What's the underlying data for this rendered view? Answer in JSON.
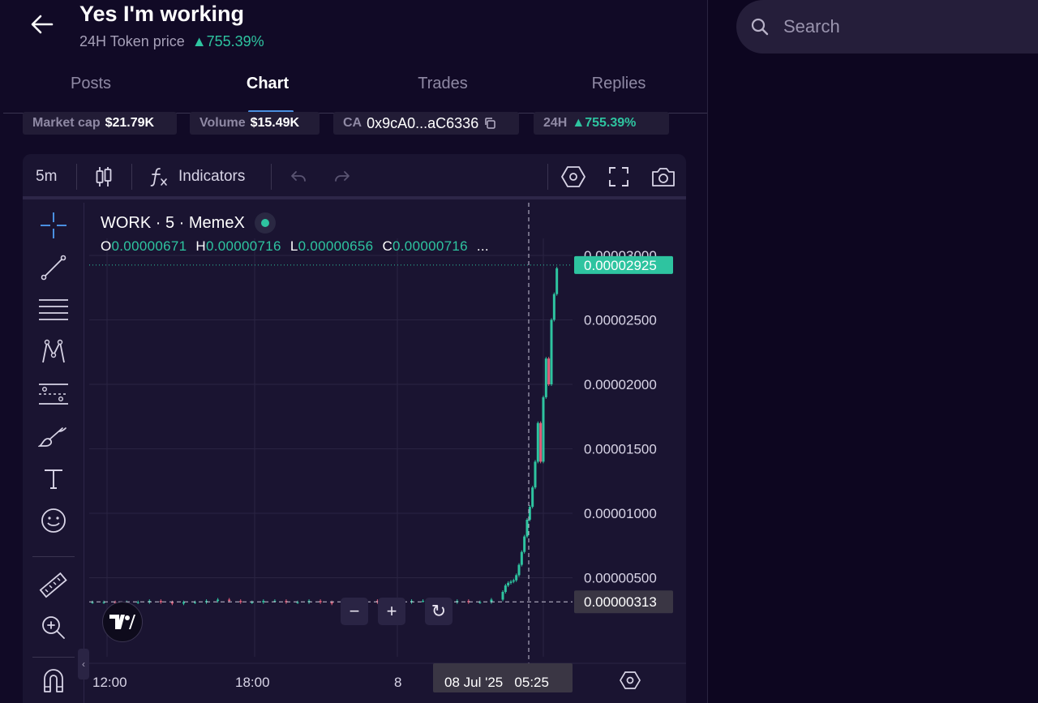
{
  "header": {
    "title": "Yes I'm working",
    "subtitle_label": "24H Token price",
    "subtitle_change": "▲755.39%"
  },
  "tabs": [
    {
      "label": "Posts"
    },
    {
      "label": "Chart"
    },
    {
      "label": "Trades"
    },
    {
      "label": "Replies"
    }
  ],
  "active_tab": "Chart",
  "stats": {
    "market_cap_label": "Market cap",
    "market_cap_value": "$21.79K",
    "volume_label": "Volume",
    "volume_value": "$15.49K",
    "ca_label": "CA",
    "ca_value": "0x9cA0...aC6336",
    "h24_label": "24H",
    "h24_value": "▲755.39%"
  },
  "toolbar": {
    "interval": "5m",
    "indicators_label": "Indicators"
  },
  "legend": {
    "symbol": "WORK · 5 · MemeX",
    "o_label": "O",
    "o_value": "0.00000671",
    "h_label": "H",
    "h_value": "0.00000716",
    "l_label": "L",
    "l_value": "0.00000656",
    "c_label": "C",
    "c_value": "0.00000716",
    "more": "..."
  },
  "price_scale": {
    "ticks": [
      "0.00003000",
      "0.00002500",
      "0.00002000",
      "0.00001500",
      "0.00001000",
      "0.00000500"
    ],
    "last_price_label": "0.00002925",
    "crosshair_price_label": "0.00000313"
  },
  "time_scale": {
    "ticks": [
      "12:00",
      "18:00",
      "8"
    ],
    "crosshair_time_label": "08 Jul '25   05:25"
  },
  "zoom_controls": {
    "minus": "−",
    "plus": "+",
    "reset": "↻"
  },
  "search": {
    "placeholder": "Search"
  },
  "colors": {
    "up": "#2ec4a0",
    "down": "#e0607a",
    "background": "#0d0620",
    "panel": "#110a26",
    "chart_bg": "#1a1431",
    "accent": "#4a8fe0"
  },
  "chart_data": {
    "type": "candlestick",
    "symbol": "WORK",
    "interval": "5",
    "ylim": [
      0,
      3e-05
    ],
    "price_ticks": [
      5e-06,
      1e-05,
      1.5e-05,
      2e-05,
      2.5e-05,
      3e-05
    ],
    "time_ticks": [
      "12:00",
      "18:00",
      "8"
    ],
    "last_price": 2.925e-05,
    "crosshair": {
      "price": 3.13e-06,
      "time": "08 Jul '25 05:25"
    },
    "closes": [
      3.1e-06,
      3.1e-06,
      3e-06,
      3.1e-06,
      3.1e-06,
      3.2e-06,
      3.1e-06,
      3e-06,
      3.1e-06,
      3.1e-06,
      3.2e-06,
      3.3e-06,
      3.2e-06,
      3.1e-06,
      3.1e-06,
      3.2e-06,
      3.2e-06,
      3.1e-06,
      3.1e-06,
      3.2e-06,
      3.1e-06,
      3e-06,
      3.1e-06,
      3.1e-06,
      3.2e-06,
      3.1e-06,
      3e-06,
      3.1e-06,
      3.2e-06,
      3.2e-06,
      3.1e-06,
      3.1e-06,
      3.2e-06,
      3.1e-06,
      3.1e-06,
      3.3e-06,
      3.9e-06,
      4.4e-06,
      4.6e-06,
      4.7e-06,
      4.8e-06,
      5.2e-06,
      6e-06,
      7e-06,
      8.2e-06,
      9.5e-06,
      1.05e-05,
      1.2e-05,
      1.4e-05,
      1.7e-05,
      1.4e-05,
      1.9e-05,
      2.2e-05,
      2e-05,
      2.5e-05,
      2.7e-05,
      2.9e-05
    ]
  }
}
